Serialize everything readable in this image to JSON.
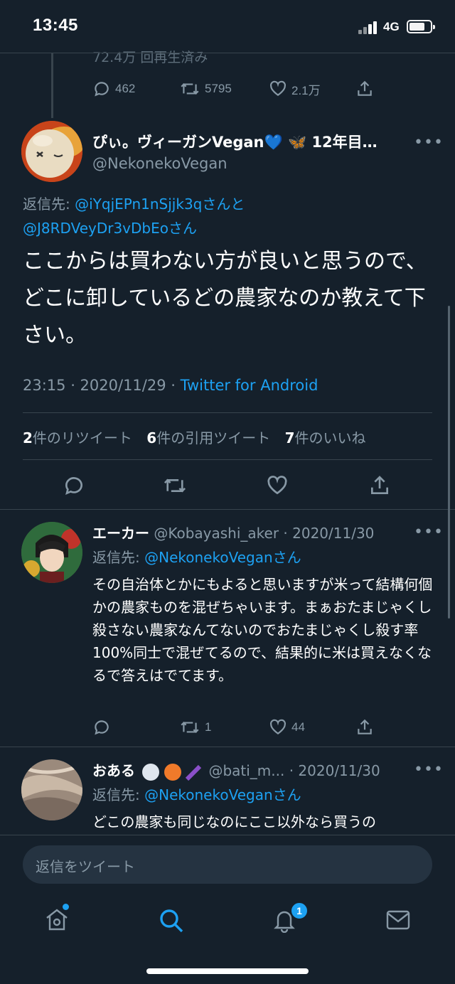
{
  "status_bar": {
    "time": "13:45",
    "network": "4G"
  },
  "prev_tweet": {
    "views_partial": "72.4万 回再生済み",
    "actions": {
      "replies": "462",
      "retweets": "5795",
      "likes": "2.1万"
    }
  },
  "main_tweet": {
    "display_name": "ぴぃ。ヴィーガンVegan",
    "name_suffix": "12年目…",
    "heart_emoji": "💙",
    "butterfly_emoji": "🦋",
    "handle": "@NekonekoVegan",
    "reply_prefix": "返信先: ",
    "reply_to_1": "@iYqjEPn1nSjjk3qさんと",
    "reply_to_2": "@J8RDVeyDr3vDbEoさん",
    "text": "ここからは買わない方が良いと思うので、どこに卸しているどの農家なのか教えて下さい。",
    "time": "23:15 · 2020/11/29 · ",
    "source": "Twitter for Android",
    "stats": {
      "retweets_count": "2",
      "retweets_label": "件のリツイート",
      "quotes_count": "6",
      "quotes_label": "件の引用ツイート",
      "likes_count": "7",
      "likes_label": "件のいいね"
    }
  },
  "replies": [
    {
      "display_name": "エーカー",
      "handle_date": " @Kobayashi_aker · 2020/11/30",
      "reply_prefix": "返信先: ",
      "reply_to": "@NekonekoVeganさん",
      "text": "その自治体とかにもよると思いますが米って結構何個かの農家ものを混ぜちゃいます。まぁおたまじゃくし殺さない農家なんてないのでおたまじゃくし殺す率100%同士で混ぜてるので、結果的に米は買えなくなるで答えはでてます。",
      "actions": {
        "replies": "",
        "retweets": "1",
        "likes": "44"
      }
    },
    {
      "display_name": "おある",
      "handle_date": " @bati_m... · 2020/11/30",
      "reply_prefix": "返信先: ",
      "reply_to": "@NekonekoVeganさん",
      "text": "どこの農家も同じなのにここ以外なら買うの"
    }
  ],
  "composer": {
    "placeholder": "返信をツイート"
  },
  "nav": {
    "notification_badge": "1"
  },
  "colors": {
    "background": "#15202b",
    "accent": "#1da1f2",
    "muted": "#8899a6",
    "divider": "#38444d"
  }
}
